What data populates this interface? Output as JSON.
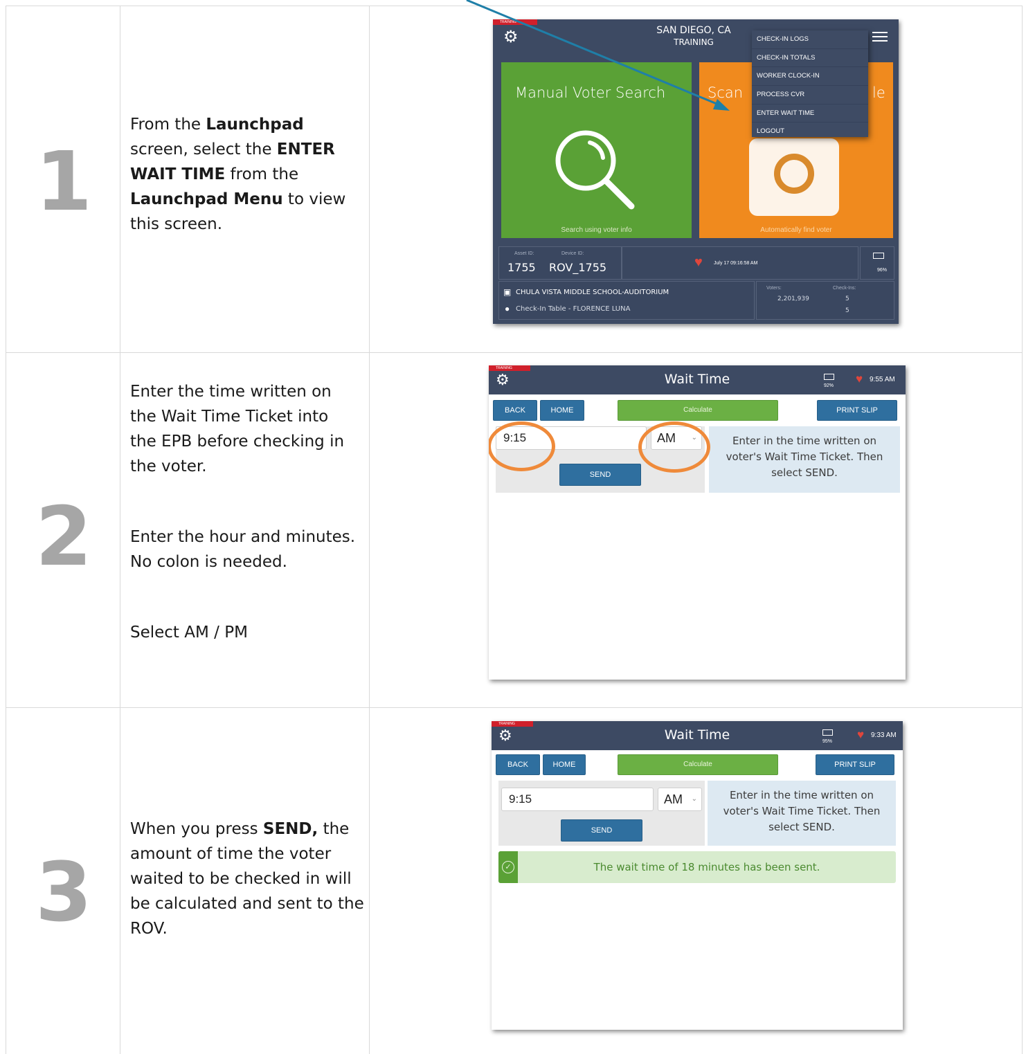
{
  "colors": {
    "header": "#3d4a63",
    "green_tile": "#5aa136",
    "orange_tile": "#f08a1e",
    "send_blue": "#2f6f9f",
    "calc_green": "#6bb044",
    "highlight_ring": "#ef8a3a",
    "arrow": "#1f7fa8",
    "step_number_grey": "#a6a6a6"
  },
  "steps": [
    {
      "number": "1",
      "text_parts": [
        "From the ",
        "Launchpad",
        " screen, select the ",
        "ENTER WAIT TIME",
        " from the ",
        "Launchpad Menu",
        " to view this screen."
      ]
    },
    {
      "number": "2",
      "para1": "Enter the time written on the Wait Time Ticket into the EPB before checking in the voter.",
      "para2": "Enter the hour and minutes. No colon is needed.",
      "para3": "Select AM / PM"
    },
    {
      "number": "3",
      "text_parts": [
        "When you press ",
        "SEND,",
        " the amount of time the voter waited to be checked in will be calculated and sent to the ROV."
      ]
    }
  ],
  "launchpad": {
    "training_flag": "TRAINING",
    "location": "SAN DIEGO, CA",
    "mode": "TRAINING",
    "menu": [
      "CHECK-IN LOGS",
      "CHECK-IN TOTALS",
      "WORKER CLOCK-IN",
      "PROCESS CVR",
      "ENTER WAIT TIME",
      "LOGOUT"
    ],
    "tile_manual": "Manual Voter Search",
    "tile_manual_sub": "Search using voter info",
    "tile_scan_left": "Scan",
    "tile_scan_right": "le",
    "tile_scan_sub": "Automatically find voter",
    "asset_label": "Asset ID:",
    "asset_id": "1755",
    "device_label": "Device ID:",
    "device_id": "ROV_1755",
    "timestamp": "July 17 09:16:58 AM",
    "battery": "96%",
    "site": "CHULA VISTA MIDDLE SCHOOL-AUDITORIUM",
    "table": "Check-In Table - FLORENCE LUNA",
    "voters_label": "Voters:",
    "voters": "2,201,939",
    "checkins_label": "Check-Ins:",
    "checkins_a": "5",
    "checkins_b": "5"
  },
  "waittime_2": {
    "training_flag": "TRAINING",
    "title": "Wait Time",
    "battery": "92%",
    "clock": "9:55 AM",
    "back": "BACK",
    "home": "HOME",
    "calculate": "Calculate",
    "print": "PRINT SLIP",
    "time_value": "9:15",
    "ampm": "AM",
    "send": "SEND",
    "help": "Enter in the time written on voter's Wait Time Ticket. Then select SEND."
  },
  "waittime_3": {
    "training_flag": "TRAINING",
    "title": "Wait Time",
    "battery": "95%",
    "clock": "9:33 AM",
    "back": "BACK",
    "home": "HOME",
    "calculate": "Calculate",
    "print": "PRINT SLIP",
    "time_value": "9:15",
    "ampm": "AM",
    "send": "SEND",
    "help": "Enter in the time written on voter's Wait Time Ticket. Then select SEND.",
    "success": "The wait time of 18 minutes has been sent."
  }
}
